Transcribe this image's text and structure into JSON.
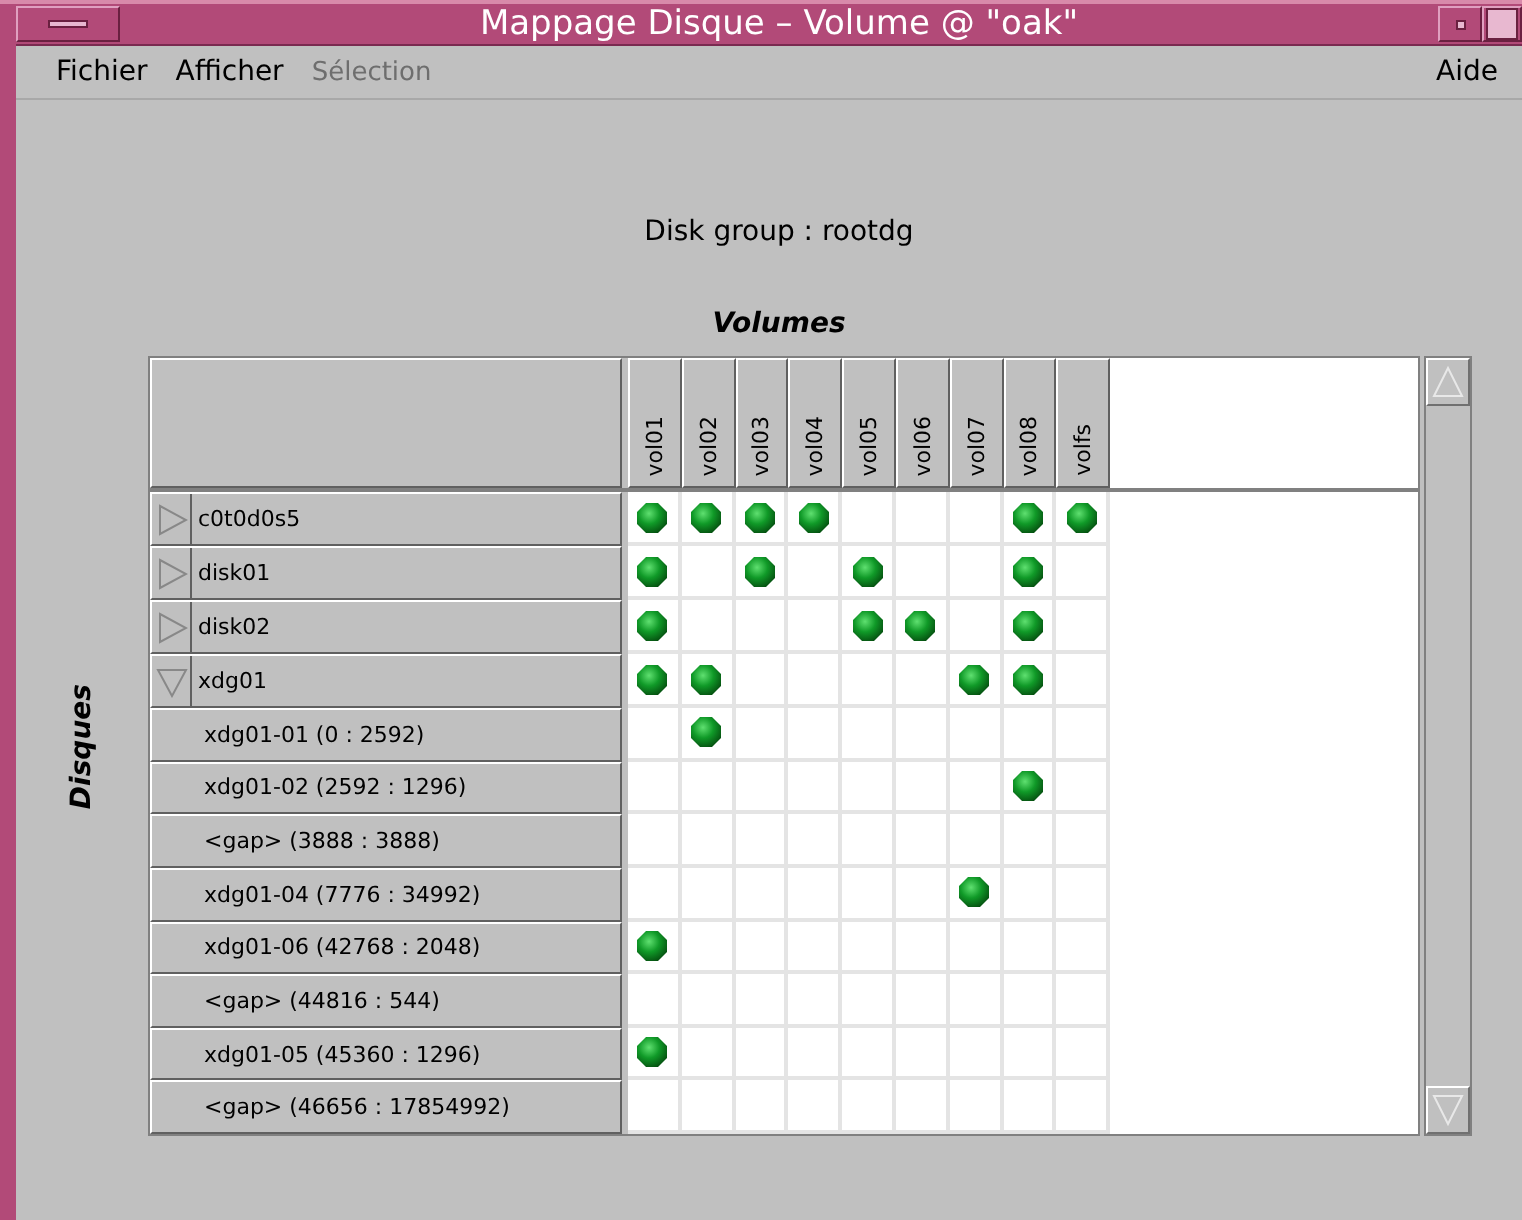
{
  "window": {
    "title": "Mappage Disque – Volume @ \"oak\""
  },
  "menu": [
    {
      "label": "Fichier",
      "disabled": false
    },
    {
      "label": "Afficher",
      "disabled": false
    },
    {
      "label": "Sélection",
      "disabled": true
    }
  ],
  "help_menu": "Aide",
  "disk_group": "Disk group : rootdg",
  "volumes_title": "Volumes",
  "disks_title": "Disques",
  "volumes": [
    "vol01",
    "vol02",
    "vol03",
    "vol04",
    "vol05",
    "vol06",
    "vol07",
    "vol08",
    "volfs"
  ],
  "rows": [
    {
      "kind": "disk",
      "name": "c0t0d0s5",
      "expanded": false,
      "used": [
        true,
        true,
        true,
        true,
        false,
        false,
        false,
        true,
        true
      ]
    },
    {
      "kind": "disk",
      "name": "disk01",
      "expanded": false,
      "used": [
        true,
        false,
        true,
        false,
        true,
        false,
        false,
        true,
        false
      ]
    },
    {
      "kind": "disk",
      "name": "disk02",
      "expanded": false,
      "used": [
        true,
        false,
        false,
        false,
        true,
        true,
        false,
        true,
        false
      ]
    },
    {
      "kind": "disk",
      "name": "xdg01",
      "expanded": true,
      "used": [
        true,
        true,
        false,
        false,
        false,
        false,
        true,
        true,
        false
      ]
    },
    {
      "kind": "subdisk",
      "name": "xdg01-01 (0 : 2592)",
      "used": [
        false,
        true,
        false,
        false,
        false,
        false,
        false,
        false,
        false
      ]
    },
    {
      "kind": "subdisk",
      "name": "xdg01-02 (2592 : 1296)",
      "used": [
        false,
        false,
        false,
        false,
        false,
        false,
        false,
        true,
        false
      ]
    },
    {
      "kind": "subdisk",
      "name": "<gap> (3888 : 3888)",
      "used": [
        false,
        false,
        false,
        false,
        false,
        false,
        false,
        false,
        false
      ]
    },
    {
      "kind": "subdisk",
      "name": "xdg01-04 (7776 : 34992)",
      "used": [
        false,
        false,
        false,
        false,
        false,
        false,
        true,
        false,
        false
      ]
    },
    {
      "kind": "subdisk",
      "name": "xdg01-06 (42768 : 2048)",
      "used": [
        true,
        false,
        false,
        false,
        false,
        false,
        false,
        false,
        false
      ]
    },
    {
      "kind": "subdisk",
      "name": "<gap> (44816 : 544)",
      "used": [
        false,
        false,
        false,
        false,
        false,
        false,
        false,
        false,
        false
      ]
    },
    {
      "kind": "subdisk",
      "name": "xdg01-05 (45360 : 1296)",
      "used": [
        true,
        false,
        false,
        false,
        false,
        false,
        false,
        false,
        false
      ]
    },
    {
      "kind": "subdisk",
      "name": "<gap> (46656 : 17854992)",
      "used": [
        false,
        false,
        false,
        false,
        false,
        false,
        false,
        false,
        false
      ]
    }
  ]
}
